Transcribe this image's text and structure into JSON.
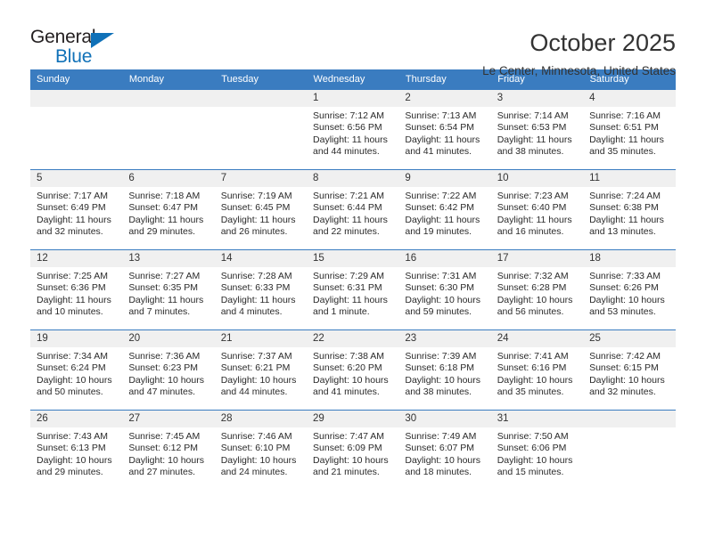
{
  "brand": {
    "name_top": "General",
    "name_bottom": "Blue",
    "accent_color": "#1071b8"
  },
  "header": {
    "month_title": "October 2025",
    "location": "Le Center, Minnesota, United States"
  },
  "calendar": {
    "header_bg": "#3a7cc0",
    "daynum_bg": "#f0f0f0",
    "weekday_labels": [
      "Sunday",
      "Monday",
      "Tuesday",
      "Wednesday",
      "Thursday",
      "Friday",
      "Saturday"
    ],
    "labels": {
      "sunrise_prefix": "Sunrise:",
      "sunset_prefix": "Sunset:",
      "daylight_prefix": "Daylight:"
    },
    "weeks": [
      [
        {
          "day": "",
          "empty": true
        },
        {
          "day": "",
          "empty": true
        },
        {
          "day": "",
          "empty": true
        },
        {
          "day": "1",
          "sunrise": "Sunrise: 7:12 AM",
          "sunset": "Sunset: 6:56 PM",
          "daylight": "Daylight: 11 hours and 44 minutes."
        },
        {
          "day": "2",
          "sunrise": "Sunrise: 7:13 AM",
          "sunset": "Sunset: 6:54 PM",
          "daylight": "Daylight: 11 hours and 41 minutes."
        },
        {
          "day": "3",
          "sunrise": "Sunrise: 7:14 AM",
          "sunset": "Sunset: 6:53 PM",
          "daylight": "Daylight: 11 hours and 38 minutes."
        },
        {
          "day": "4",
          "sunrise": "Sunrise: 7:16 AM",
          "sunset": "Sunset: 6:51 PM",
          "daylight": "Daylight: 11 hours and 35 minutes."
        }
      ],
      [
        {
          "day": "5",
          "sunrise": "Sunrise: 7:17 AM",
          "sunset": "Sunset: 6:49 PM",
          "daylight": "Daylight: 11 hours and 32 minutes."
        },
        {
          "day": "6",
          "sunrise": "Sunrise: 7:18 AM",
          "sunset": "Sunset: 6:47 PM",
          "daylight": "Daylight: 11 hours and 29 minutes."
        },
        {
          "day": "7",
          "sunrise": "Sunrise: 7:19 AM",
          "sunset": "Sunset: 6:45 PM",
          "daylight": "Daylight: 11 hours and 26 minutes."
        },
        {
          "day": "8",
          "sunrise": "Sunrise: 7:21 AM",
          "sunset": "Sunset: 6:44 PM",
          "daylight": "Daylight: 11 hours and 22 minutes."
        },
        {
          "day": "9",
          "sunrise": "Sunrise: 7:22 AM",
          "sunset": "Sunset: 6:42 PM",
          "daylight": "Daylight: 11 hours and 19 minutes."
        },
        {
          "day": "10",
          "sunrise": "Sunrise: 7:23 AM",
          "sunset": "Sunset: 6:40 PM",
          "daylight": "Daylight: 11 hours and 16 minutes."
        },
        {
          "day": "11",
          "sunrise": "Sunrise: 7:24 AM",
          "sunset": "Sunset: 6:38 PM",
          "daylight": "Daylight: 11 hours and 13 minutes."
        }
      ],
      [
        {
          "day": "12",
          "sunrise": "Sunrise: 7:25 AM",
          "sunset": "Sunset: 6:36 PM",
          "daylight": "Daylight: 11 hours and 10 minutes."
        },
        {
          "day": "13",
          "sunrise": "Sunrise: 7:27 AM",
          "sunset": "Sunset: 6:35 PM",
          "daylight": "Daylight: 11 hours and 7 minutes."
        },
        {
          "day": "14",
          "sunrise": "Sunrise: 7:28 AM",
          "sunset": "Sunset: 6:33 PM",
          "daylight": "Daylight: 11 hours and 4 minutes."
        },
        {
          "day": "15",
          "sunrise": "Sunrise: 7:29 AM",
          "sunset": "Sunset: 6:31 PM",
          "daylight": "Daylight: 11 hours and 1 minute."
        },
        {
          "day": "16",
          "sunrise": "Sunrise: 7:31 AM",
          "sunset": "Sunset: 6:30 PM",
          "daylight": "Daylight: 10 hours and 59 minutes."
        },
        {
          "day": "17",
          "sunrise": "Sunrise: 7:32 AM",
          "sunset": "Sunset: 6:28 PM",
          "daylight": "Daylight: 10 hours and 56 minutes."
        },
        {
          "day": "18",
          "sunrise": "Sunrise: 7:33 AM",
          "sunset": "Sunset: 6:26 PM",
          "daylight": "Daylight: 10 hours and 53 minutes."
        }
      ],
      [
        {
          "day": "19",
          "sunrise": "Sunrise: 7:34 AM",
          "sunset": "Sunset: 6:24 PM",
          "daylight": "Daylight: 10 hours and 50 minutes."
        },
        {
          "day": "20",
          "sunrise": "Sunrise: 7:36 AM",
          "sunset": "Sunset: 6:23 PM",
          "daylight": "Daylight: 10 hours and 47 minutes."
        },
        {
          "day": "21",
          "sunrise": "Sunrise: 7:37 AM",
          "sunset": "Sunset: 6:21 PM",
          "daylight": "Daylight: 10 hours and 44 minutes."
        },
        {
          "day": "22",
          "sunrise": "Sunrise: 7:38 AM",
          "sunset": "Sunset: 6:20 PM",
          "daylight": "Daylight: 10 hours and 41 minutes."
        },
        {
          "day": "23",
          "sunrise": "Sunrise: 7:39 AM",
          "sunset": "Sunset: 6:18 PM",
          "daylight": "Daylight: 10 hours and 38 minutes."
        },
        {
          "day": "24",
          "sunrise": "Sunrise: 7:41 AM",
          "sunset": "Sunset: 6:16 PM",
          "daylight": "Daylight: 10 hours and 35 minutes."
        },
        {
          "day": "25",
          "sunrise": "Sunrise: 7:42 AM",
          "sunset": "Sunset: 6:15 PM",
          "daylight": "Daylight: 10 hours and 32 minutes."
        }
      ],
      [
        {
          "day": "26",
          "sunrise": "Sunrise: 7:43 AM",
          "sunset": "Sunset: 6:13 PM",
          "daylight": "Daylight: 10 hours and 29 minutes."
        },
        {
          "day": "27",
          "sunrise": "Sunrise: 7:45 AM",
          "sunset": "Sunset: 6:12 PM",
          "daylight": "Daylight: 10 hours and 27 minutes."
        },
        {
          "day": "28",
          "sunrise": "Sunrise: 7:46 AM",
          "sunset": "Sunset: 6:10 PM",
          "daylight": "Daylight: 10 hours and 24 minutes."
        },
        {
          "day": "29",
          "sunrise": "Sunrise: 7:47 AM",
          "sunset": "Sunset: 6:09 PM",
          "daylight": "Daylight: 10 hours and 21 minutes."
        },
        {
          "day": "30",
          "sunrise": "Sunrise: 7:49 AM",
          "sunset": "Sunset: 6:07 PM",
          "daylight": "Daylight: 10 hours and 18 minutes."
        },
        {
          "day": "31",
          "sunrise": "Sunrise: 7:50 AM",
          "sunset": "Sunset: 6:06 PM",
          "daylight": "Daylight: 10 hours and 15 minutes."
        },
        {
          "day": "",
          "empty": true
        }
      ]
    ]
  }
}
